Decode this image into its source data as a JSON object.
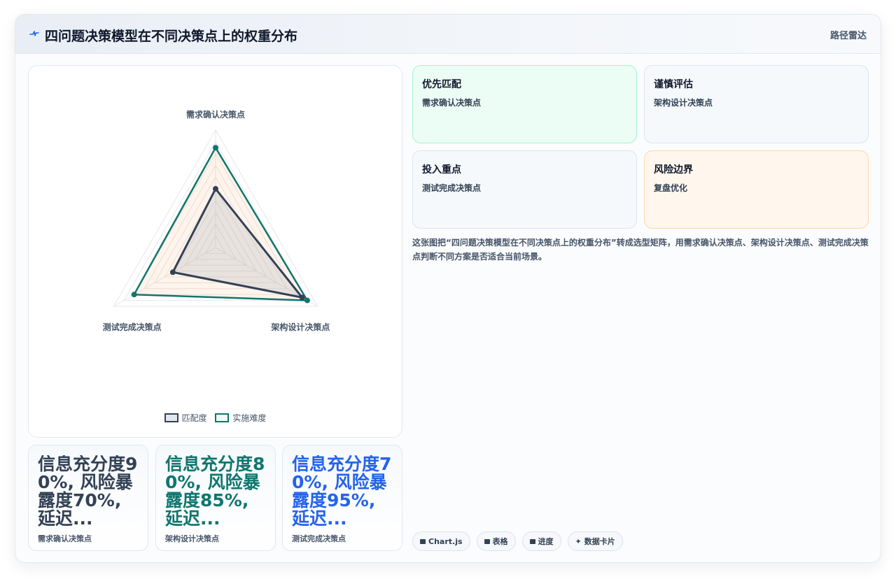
{
  "header": {
    "title": "四问题决策模型在不同决策点上的权重分布",
    "tag": "路径雷达",
    "icon": "pulse-icon"
  },
  "chart_data": {
    "type": "radar",
    "categories": [
      "需求确认决策点",
      "架构设计决策点",
      "测试完成决策点"
    ],
    "series": [
      {
        "name": "匹配度",
        "values": [
          50,
          85,
          42
        ],
        "color": "#334155",
        "fill": "rgba(148,163,184,0.22)"
      },
      {
        "name": "实施难度",
        "values": [
          85,
          90,
          80
        ],
        "color": "#0f766e",
        "fill": "rgba(251,146,60,0.10)"
      }
    ],
    "rlim": [
      0,
      100
    ],
    "grid": true,
    "legend": "bottom"
  },
  "stats": [
    {
      "value": "信息充分度90%, 风险暴露度70%, 延迟...",
      "label": "需求确认决策点",
      "color": "#334155"
    },
    {
      "value": "信息充分度80%, 风险暴露度85%, 延迟...",
      "label": "架构设计决策点",
      "color": "#0f766e"
    },
    {
      "value": "信息充分度70%, 风险暴露度95%, 延迟...",
      "label": "测试完成决策点",
      "color": "#2563eb"
    }
  ],
  "tiles": [
    {
      "title": "优先匹配",
      "subtitle": "需求确认决策点",
      "bg": "#ecfdf5",
      "border": "#a7f3d0"
    },
    {
      "title": "谨慎评估",
      "subtitle": "架构设计决策点",
      "bg": "#f6f9fc",
      "border": "#dbe4ee"
    },
    {
      "title": "投入重点",
      "subtitle": "测试完成决策点",
      "bg": "#f6f9fc",
      "border": "#dbe4ee"
    },
    {
      "title": "风险边界",
      "subtitle": "复盘优化",
      "bg": "#fff7ed",
      "border": "#fed7aa"
    }
  ],
  "description": "这张图把“四问题决策模型在不同决策点上的权重分布”转成选型矩阵，用需求确认决策点、架构设计决策点、测试完成决策点判断不同方案是否适合当前场景。",
  "chips": [
    {
      "icon": "chart-icon",
      "label": "Chart.js"
    },
    {
      "icon": "table-icon",
      "label": "表格"
    },
    {
      "icon": "progress-icon",
      "label": "进度"
    },
    {
      "icon": "sparkle-icon",
      "label": "数据卡片"
    }
  ]
}
